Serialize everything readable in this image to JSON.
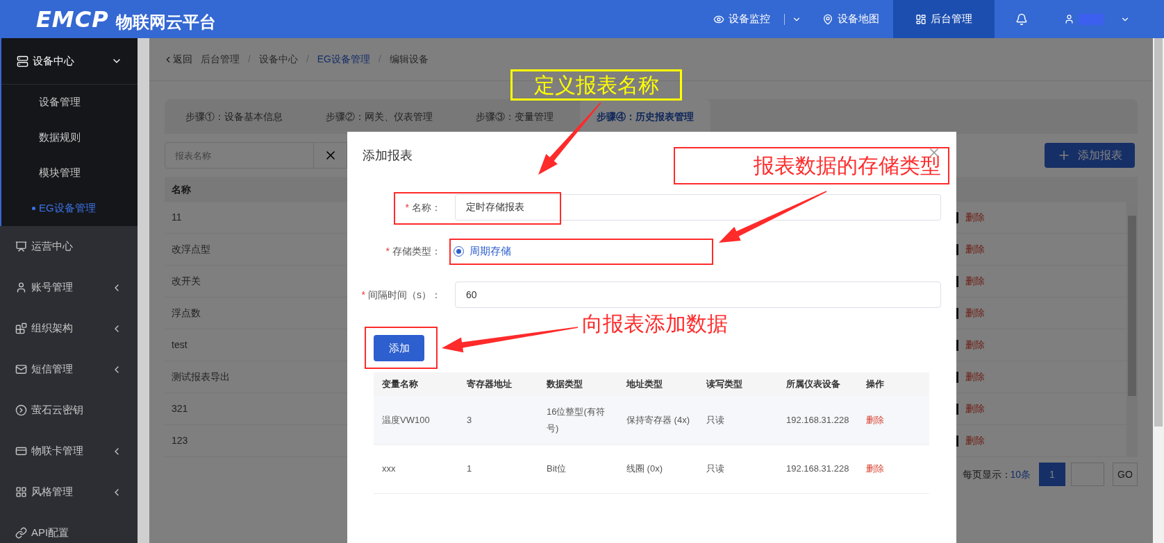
{
  "header": {
    "logo": "EMCP",
    "title": "物联网云平台",
    "nav": [
      {
        "label": "设备监控",
        "selected": false,
        "has_menu": true
      },
      {
        "label": "设备地图",
        "selected": false,
        "has_menu": false
      },
      {
        "label": "后台管理",
        "selected": true,
        "has_menu": false
      }
    ]
  },
  "sidebar": {
    "items": [
      {
        "label": "设备中心",
        "expanded": true,
        "children": [
          {
            "label": "设备管理",
            "selected": false
          },
          {
            "label": "数据规则",
            "selected": false
          },
          {
            "label": "模块管理",
            "selected": false
          },
          {
            "label": "EG设备管理",
            "selected": true
          }
        ]
      },
      {
        "label": "运营中心"
      },
      {
        "label": "账号管理",
        "expanded": false
      },
      {
        "label": "组织架构",
        "expanded": false
      },
      {
        "label": "短信管理",
        "expanded": false
      },
      {
        "label": "萤石云密钥"
      },
      {
        "label": "物联卡管理",
        "expanded": false
      },
      {
        "label": "风格管理",
        "expanded": false
      },
      {
        "label": "API配置"
      }
    ]
  },
  "breadcrumb": {
    "back": "返回",
    "separator": "/",
    "items": [
      {
        "label": "后台管理",
        "kind": "text"
      },
      {
        "label": "设备中心",
        "kind": "text"
      },
      {
        "label": "EG设备管理",
        "kind": "link"
      },
      {
        "label": "编辑设备",
        "kind": "text"
      }
    ]
  },
  "steps": [
    {
      "label": "步骤①：设备基本信息",
      "selected": false
    },
    {
      "label": "步骤②：网关、仪表管理",
      "selected": false
    },
    {
      "label": "步骤③：变量管理",
      "selected": false
    },
    {
      "label": "步骤④：历史报表管理",
      "selected": true
    }
  ],
  "search": {
    "placeholder": "报表名称"
  },
  "add_report_button": "添加报表",
  "report_table": {
    "column": "名称",
    "rows": [
      {
        "name": "11",
        "action": "删除"
      },
      {
        "name": "改浮点型",
        "action": "删除"
      },
      {
        "name": "改开关",
        "action": "删除"
      },
      {
        "name": "浮点数",
        "action": "删除"
      },
      {
        "name": "test",
        "action": "删除"
      },
      {
        "name": "测试报表导出",
        "action": "删除"
      },
      {
        "name": "321",
        "action": "删除"
      },
      {
        "name": "123",
        "action": "删除"
      }
    ]
  },
  "pagination": {
    "label": "每页显示：",
    "per_page": "10条",
    "page": "1",
    "go": "GO"
  },
  "dialog": {
    "title": "添加报表",
    "fields": [
      {
        "kind": "text",
        "required_mark": "*",
        "label": "名称：",
        "value": "定时存储报表"
      },
      {
        "kind": "radio",
        "required_mark": "*",
        "label": "存储类型：",
        "options": [
          {
            "label": "周期存储",
            "selected": true
          }
        ]
      },
      {
        "kind": "text",
        "required_mark": "*",
        "label": "间隔时间（s）：",
        "value": "60"
      }
    ],
    "add_button": "添加",
    "table": {
      "columns": [
        "变量名称",
        "寄存器地址",
        "数据类型",
        "地址类型",
        "读写类型",
        "所属仪表设备",
        "操作"
      ],
      "rows": [
        {
          "cells": [
            "温度VW100",
            "3",
            "16位整型(有符号)",
            "保持寄存器 (4x)",
            "只读",
            "192.168.31.228"
          ],
          "action": "删除"
        },
        {
          "cells": [
            "xxx",
            "1",
            "Bit位",
            "线圈 (0x)",
            "只读",
            "192.168.31.228"
          ],
          "action": "删除"
        }
      ]
    }
  },
  "callouts": [
    {
      "text": "定义报表名称",
      "color": "#ffff00"
    },
    {
      "text": "报表数据的存储类型",
      "color": "#ff2a2a"
    },
    {
      "text": "向报表添加数据",
      "color": "#ff2a2a"
    }
  ]
}
